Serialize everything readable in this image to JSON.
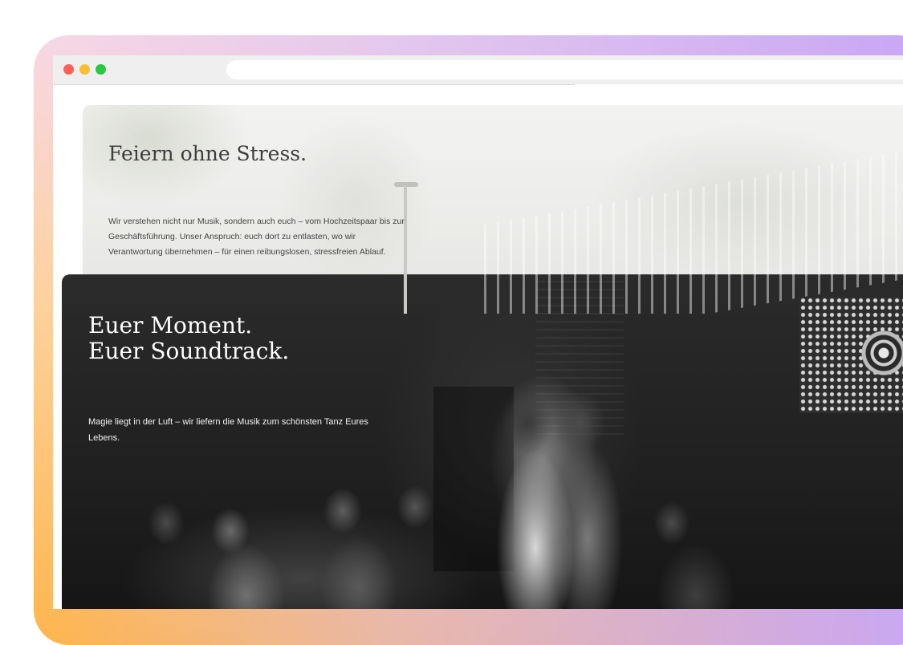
{
  "browser": {
    "traffic_lights": [
      "close",
      "minimize",
      "zoom"
    ],
    "colors": {
      "close": "#ff5f57",
      "minimize": "#febc2e",
      "zoom": "#28c840"
    },
    "url": ""
  },
  "hero_light": {
    "title": "Feiern ohne Stress.",
    "text": "Wir verstehen nicht nur Musik, sondern auch euch – vom Hochzeitspaar bis zur Geschäftsführung. Unser Anspruch: euch dort zu entlasten, wo wir Verantwortung übernehmen – für einen reibungslosen, stressfreien Ablauf."
  },
  "hero_dark": {
    "title_line1": "Euer Moment.",
    "title_line2": "Euer Soundtrack.",
    "text": "Magie liegt in der Luft – wir liefern die Musik zum schönsten Tanz Eures Lebens."
  }
}
